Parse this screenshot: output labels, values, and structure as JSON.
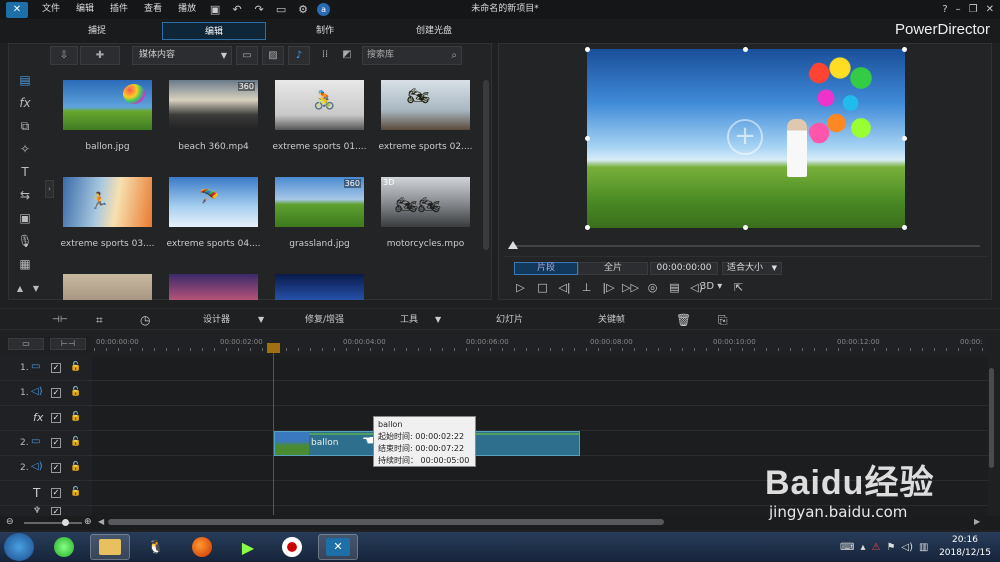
{
  "menu": {
    "items": [
      "文件",
      "编辑",
      "插件",
      "查看",
      "播放"
    ],
    "title": "未命名的新项目*"
  },
  "modes": {
    "capture": "捕捉",
    "edit": "编辑",
    "produce": "制作",
    "disc": "创建光盘",
    "brand": "PowerDirector"
  },
  "library": {
    "dropdown": "媒体内容",
    "search_placeholder": "搜索库",
    "items": [
      {
        "label": "ballon.jpg",
        "badge": ""
      },
      {
        "label": "beach 360.mp4",
        "badge": "360"
      },
      {
        "label": "extreme sports 01....",
        "badge": ""
      },
      {
        "label": "extreme sports 02....",
        "badge": ""
      },
      {
        "label": "extreme sports 03....",
        "badge": ""
      },
      {
        "label": "extreme sports 04....",
        "badge": ""
      },
      {
        "label": "grassland.jpg",
        "badge": "360"
      },
      {
        "label": "motorcycles.mpo",
        "badge": "3D"
      }
    ]
  },
  "preview": {
    "clip_btn": "片段",
    "full_btn": "全片",
    "timecode": "00:00:00:00",
    "fit": "适合大小",
    "mode_3d": "3D",
    "scrub_progress": 0
  },
  "timeline_toolbar": {
    "designer": "设计器",
    "fix": "修复/增强",
    "tools": "工具",
    "slideshow": "幻灯片",
    "keyframe": "关键帧"
  },
  "ruler": [
    "00:00:00:00",
    "00:00:02:00",
    "00:00:04:00",
    "00:00:06:00",
    "00:00:08:00",
    "00:00:10:00",
    "00:00:12:00",
    "00:00:"
  ],
  "tracks": [
    {
      "num": "1.",
      "type": "video"
    },
    {
      "num": "1.",
      "type": "audio"
    },
    {
      "num": "",
      "type": "fx"
    },
    {
      "num": "2.",
      "type": "video"
    },
    {
      "num": "2.",
      "type": "audio"
    },
    {
      "num": "",
      "type": "title"
    },
    {
      "num": "",
      "type": "voice"
    }
  ],
  "clip": {
    "name": "ballon"
  },
  "tooltip": {
    "name": "ballon",
    "start": "起始时间: 00:00:02:22",
    "end": "结束时间: 00:00:07:22",
    "duration": "持续时间：  00:00:05:00"
  },
  "taskbar": {
    "clock_time": "20:16",
    "clock_date": "2018/12/15"
  },
  "watermark": {
    "main": "Baidu经验",
    "sub": "jingyan.baidu.com"
  }
}
